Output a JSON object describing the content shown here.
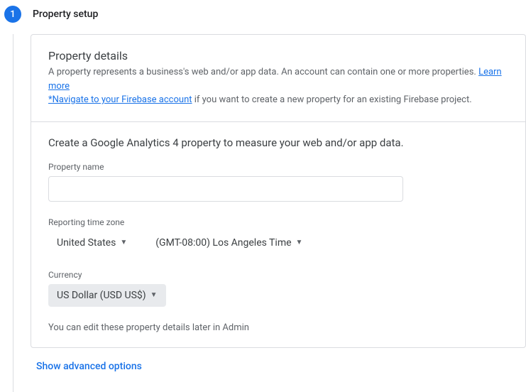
{
  "step": {
    "number": "1",
    "title": "Property setup"
  },
  "details": {
    "heading": "Property details",
    "desc_prefix": "A property represents a business's web and/or app data. An account can contain one or more properties. ",
    "learn_more": "Learn more",
    "firebase_link": "*Navigate to your Firebase account",
    "firebase_suffix": " if you want to create a new property for an existing Firebase project."
  },
  "form": {
    "create_heading": "Create a Google Analytics 4 property to measure your web and/or app data.",
    "property_name_label": "Property name",
    "property_name_value": "",
    "timezone_label": "Reporting time zone",
    "country": "United States",
    "timezone": "(GMT-08:00) Los Angeles Time",
    "currency_label": "Currency",
    "currency": "US Dollar (USD US$)",
    "hint": "You can edit these property details later in Admin"
  },
  "advanced": {
    "label": "Show advanced options"
  }
}
